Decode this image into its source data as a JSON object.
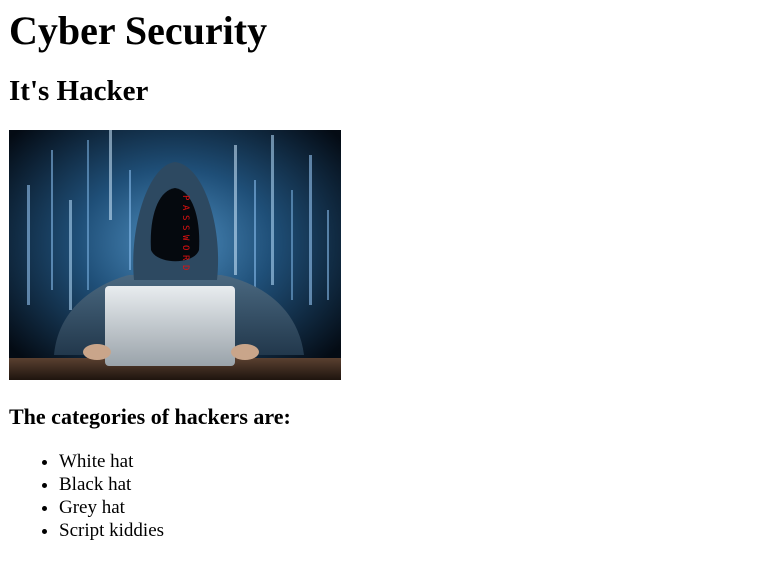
{
  "page": {
    "title": "Cyber Security",
    "subtitle": "It's Hacker",
    "image_alt": "hacker illustration",
    "image_overlay_text": "PASSWORD",
    "categories_heading": "The categories of hackers are:",
    "categories": [
      "White hat",
      "Black hat",
      "Grey hat",
      "Script kiddies"
    ]
  },
  "colors": {
    "text": "#000000",
    "background": "#ffffff",
    "image_bg_dark": "#061526",
    "image_bg_light": "#2f6f9e",
    "password_red": "#e01010"
  }
}
